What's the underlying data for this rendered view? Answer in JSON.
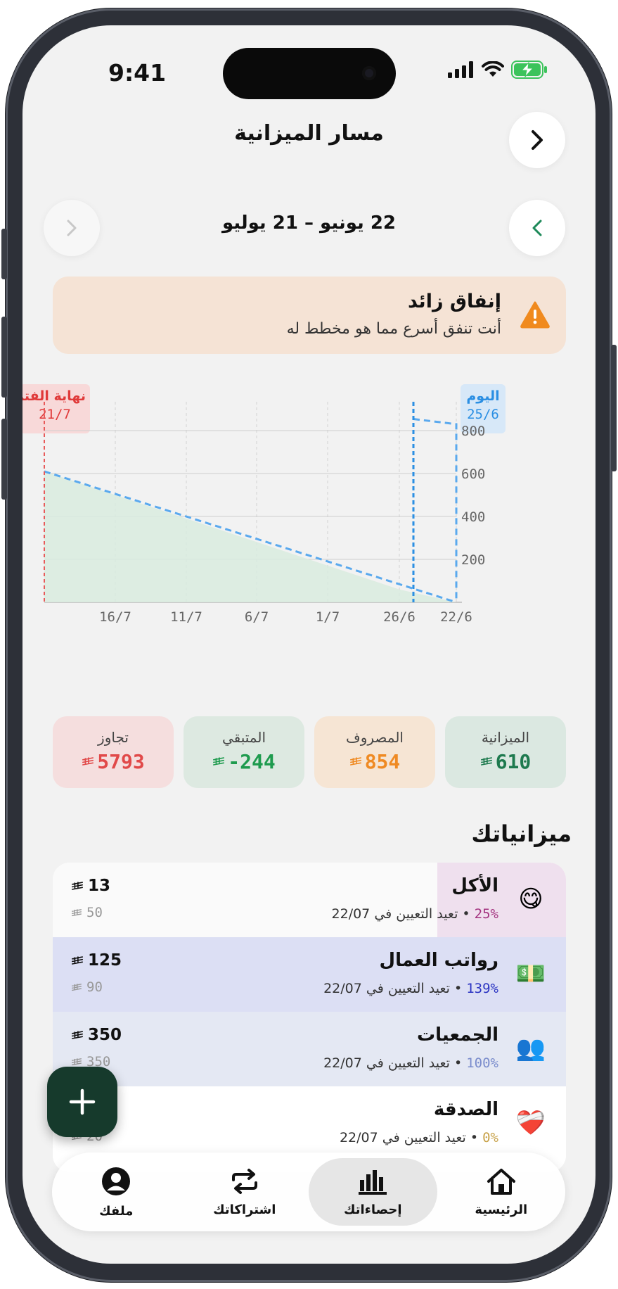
{
  "status_bar": {
    "time": "9:41"
  },
  "header": {
    "title": "مسار الميزانية"
  },
  "period": {
    "range": "22 يونيو – 21 يوليو"
  },
  "alert": {
    "title": "إنفاق زائد",
    "subtitle": "أنت تنفق أسرع مما هو مخطط له"
  },
  "markers": {
    "end_label": "نهاية الفترة",
    "end_date": "21/7",
    "today_label": "اليوم",
    "today_date": "25/6"
  },
  "chart_data": {
    "type": "line",
    "x_ticks": [
      "22/6",
      "26/6",
      "1/7",
      "6/7",
      "11/7",
      "16/7"
    ],
    "y_ticks": [
      200,
      400,
      600,
      800
    ],
    "ylim": [
      0,
      800
    ],
    "x_reversed": true,
    "series": [
      {
        "x": [
          "21/7",
          "26/6"
        ],
        "values": [
          610,
          60
        ]
      },
      {
        "x": [
          "25/6",
          "22/6",
          "22/6"
        ],
        "values": [
          854,
          830,
          0
        ]
      }
    ]
  },
  "stats": [
    {
      "label": "الميزانية",
      "value": "610",
      "color": "#1e7a4e",
      "bg": "#dbe8e1"
    },
    {
      "label": "المصروف",
      "value": "854",
      "color": "#ef8a23",
      "bg": "#f6e5d4"
    },
    {
      "label": "المتبقي",
      "value": "-244",
      "color": "#1e9b4e",
      "bg": "#dde9e1"
    },
    {
      "label": "تجاوز",
      "value": "5793",
      "color": "#e14949",
      "bg": "#f5dede"
    }
  ],
  "budgets": {
    "title": "ميزانياتك",
    "items": [
      {
        "emoji": "😋",
        "name": "الأكل",
        "percent": "25%",
        "percent_color": "#a3327f",
        "reset": " • تعيد التعيين في 22/07",
        "amount": "13",
        "budget": "50",
        "fill": 0.25,
        "fill_color": "#efe0ee",
        "bg": "#fafafa"
      },
      {
        "emoji": "💵",
        "name": "رواتب العمال",
        "percent": "139%",
        "percent_color": "#2b34c2",
        "reset": " • تعيد التعيين في 22/07",
        "amount": "125",
        "budget": "90",
        "fill": 1.0,
        "fill_color": "#dcdff4",
        "bg": "#dcdff4"
      },
      {
        "emoji": "👥",
        "name": "الجمعيات",
        "percent": "100%",
        "percent_color": "#7a8ccc",
        "reset": " • تعيد التعيين في 22/07",
        "amount": "350",
        "budget": "350",
        "fill": 1.0,
        "fill_color": "#e4e8f3",
        "bg": "#e4e8f3"
      },
      {
        "emoji": "❤️‍🩹",
        "name": "الصدقة",
        "percent": "0%",
        "percent_color": "#c8a24a",
        "reset": " • تعيد التعيين في 22/07",
        "amount": "",
        "budget": "20",
        "fill": 0,
        "fill_color": "#ffffff",
        "bg": "#ffffff"
      }
    ]
  },
  "tabs": [
    {
      "label": "الرئيسية",
      "icon": "home-icon",
      "active": false
    },
    {
      "label": "إحصاءاتك",
      "icon": "stats-icon",
      "active": true
    },
    {
      "label": "اشتراكاتك",
      "icon": "repeat-icon",
      "active": false
    },
    {
      "label": "ملفك",
      "icon": "profile-icon",
      "active": false
    }
  ],
  "colors": {
    "accent": "#1e7a4e",
    "fab": "#163a2c",
    "danger": "#e14949",
    "today": "#2b8fe3",
    "projection": "#5aa9ee"
  }
}
